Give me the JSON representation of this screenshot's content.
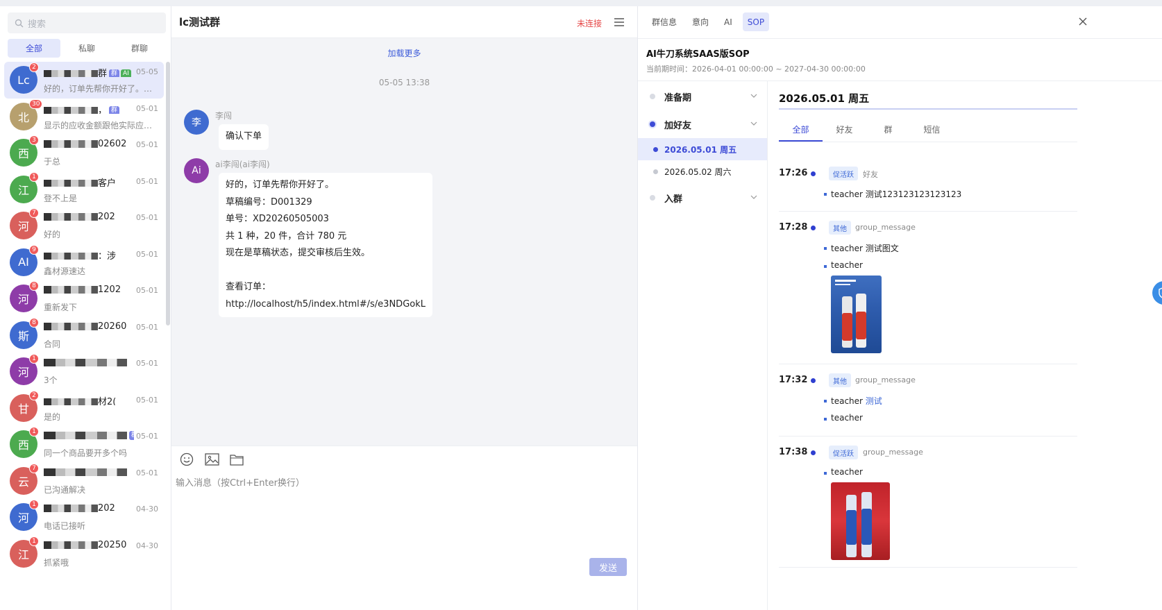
{
  "sidebar": {
    "search_placeholder": "搜索",
    "tabs": [
      {
        "label": "全部"
      },
      {
        "label": "私聊"
      },
      {
        "label": "群聊"
      }
    ],
    "conversations": [
      {
        "avatar": "Lc",
        "color": "#3f6bd0",
        "badge": "2",
        "name_tail": "群",
        "tag_group": "群",
        "tag_ai": "AI",
        "date": "05-05",
        "preview": "好的，订单先帮你开好了。…",
        "active": true
      },
      {
        "avatar": "北",
        "color": "#b7a06e",
        "badge": "30",
        "name_tail": "，",
        "tag_group": "群",
        "date": "05-01",
        "preview": "显示的应收金额跟他实际应…"
      },
      {
        "avatar": "西",
        "color": "#4caa4f",
        "badge": "3",
        "name_tail": "02602",
        "date": "05-01",
        "preview": "于总"
      },
      {
        "avatar": "江",
        "color": "#4caa4f",
        "badge": "1",
        "name_tail": "客户",
        "date": "05-01",
        "preview": "登不上是"
      },
      {
        "avatar": "河",
        "color": "#d9605c",
        "badge": "7",
        "name_tail": "202",
        "date": "05-01",
        "preview": "好的"
      },
      {
        "avatar": "AI",
        "color": "#3f6bd0",
        "badge": "9",
        "name_tail": "：涉",
        "date": "05-01",
        "preview": "鑫材源速达"
      },
      {
        "avatar": "河",
        "color": "#8e3ca8",
        "badge": "8",
        "name_tail": "1202",
        "date": "05-01",
        "preview": "重新发下"
      },
      {
        "avatar": "斯",
        "color": "#3f6bd0",
        "badge": "8",
        "name_tail": "20260",
        "date": "05-01",
        "preview": "合同"
      },
      {
        "avatar": "河",
        "color": "#8e3ca8",
        "badge": "1",
        "name_tail": "",
        "date": "05-01",
        "preview": "3个"
      },
      {
        "avatar": "甘",
        "color": "#d9605c",
        "badge": "2",
        "name_tail": "材2(",
        "date": "05-01",
        "preview": "是的"
      },
      {
        "avatar": "西",
        "color": "#4caa4f",
        "badge": "1",
        "name_tail": "",
        "tag_group": "群",
        "date": "05-01",
        "preview": "同一个商品要开多个吗"
      },
      {
        "avatar": "云",
        "color": "#d9605c",
        "badge": "7",
        "name_tail": "",
        "date": "05-01",
        "preview": "已沟通解决"
      },
      {
        "avatar": "河",
        "color": "#3f6bd0",
        "badge": "1",
        "name_tail": "202",
        "date": "04-30",
        "preview": "电话已接听"
      },
      {
        "avatar": "江",
        "color": "#d9605c",
        "badge": "1",
        "name_tail": "20250",
        "date": "04-30",
        "preview": "抓紧哦"
      }
    ]
  },
  "chat": {
    "title": "lc测试群",
    "status": "未连接",
    "load_more": "加载更多",
    "time_separator": "05-05 13:38",
    "messages": [
      {
        "avatar": "李",
        "color": "#3f6bd0",
        "sender": "李闯",
        "lines": [
          "确认下单"
        ]
      },
      {
        "avatar": "Ai",
        "color": "#8e3ca8",
        "sender": "ai李闯(ai李闯)",
        "lines": [
          "好的，订单先帮你开好了。",
          "草稿编号：D001329",
          "单号：XD20260505003",
          "共 1 种，20 件，合计 780 元",
          "现在是草稿状态，提交审核后生效。",
          "",
          "查看订单：",
          "http://localhost/h5/index.html#/s/e3NDGokL"
        ]
      }
    ],
    "input_placeholder": "输入消息（按Ctrl+Enter换行）",
    "send_label": "发送"
  },
  "panel": {
    "tabs": [
      {
        "label": "群信息"
      },
      {
        "label": "意向"
      },
      {
        "label": "AI"
      },
      {
        "label": "SOP",
        "active": true
      }
    ],
    "sop_title": "AI牛刀系统SAAS版SOP",
    "period": "当前期时间：2026-04-01 00:00:00 ~ 2027-04-30 00:00:00",
    "stages": {
      "prep": "准备期",
      "add_friend": "加好友",
      "day1": "2026.05.01 周五",
      "day2": "2026.05.02 周六",
      "join_group": "入群"
    },
    "detail": {
      "date": "2026.05.01 周五",
      "tabs": [
        {
          "label": "全部"
        },
        {
          "label": "好友"
        },
        {
          "label": "群"
        },
        {
          "label": "短信"
        }
      ],
      "tasks": [
        {
          "time": "17:26",
          "tag": "促活跃",
          "type": "好友",
          "lines": [
            {
              "who": "teacher",
              "text": "测试123123123123123"
            }
          ]
        },
        {
          "time": "17:28",
          "tag": "其他",
          "type": "group_message",
          "lines": [
            {
              "who": "teacher",
              "text": "测试图文"
            },
            {
              "who": "teacher",
              "text": ""
            }
          ]
        },
        {
          "time": "17:32",
          "tag": "其他",
          "type": "group_message",
          "lines": [
            {
              "who": "teacher",
              "text": "测试"
            },
            {
              "who": "teacher",
              "text": ""
            }
          ]
        },
        {
          "time": "17:38",
          "tag": "促活跃",
          "type": "group_message",
          "lines": [
            {
              "who": "teacher",
              "text": ""
            }
          ]
        }
      ]
    }
  }
}
